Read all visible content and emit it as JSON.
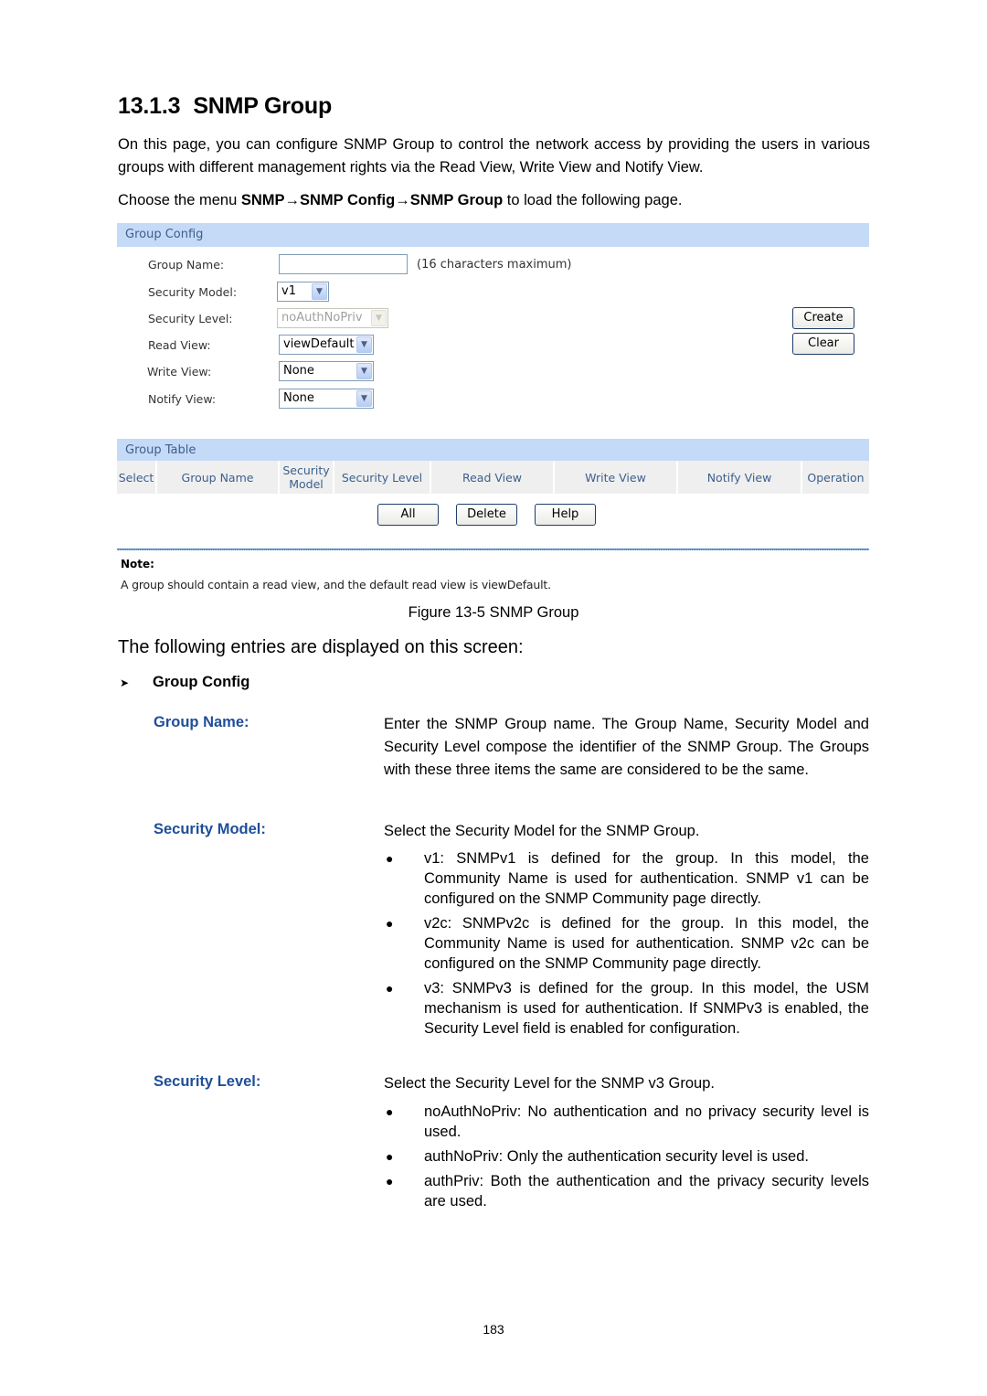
{
  "section": {
    "number": "13.1.3",
    "title": "SNMP Group",
    "intro": "On this page, you can configure SNMP Group to control the network access by providing the users in various groups with different management rights via the Read View, Write View and Notify View.",
    "menu_prefix": "Choose the menu ",
    "menu_path": "SNMP→SNMP Config→SNMP Group",
    "menu_suffix": " to load the following page."
  },
  "figure": {
    "group_config": {
      "header": "Group Config",
      "fields": {
        "group_name": {
          "label": "Group Name:",
          "value": "",
          "hint": "(16 characters maximum)"
        },
        "security_model": {
          "label": "Security Model:",
          "value": "v1"
        },
        "security_level": {
          "label": "Security Level:",
          "value": "noAuthNoPriv",
          "disabled": true
        },
        "read_view": {
          "label": "Read View:",
          "value": "viewDefault"
        },
        "write_view": {
          "label": "Write View:",
          "value": "None"
        },
        "notify_view": {
          "label": "Notify View:",
          "value": "None"
        }
      },
      "buttons": {
        "create": "Create",
        "clear": "Clear"
      }
    },
    "group_table": {
      "header": "Group Table",
      "columns": [
        "Select",
        "Group Name",
        "Security Model",
        "Security Level",
        "Read View",
        "Write View",
        "Notify View",
        "Operation"
      ],
      "buttons": {
        "all": "All",
        "delete": "Delete",
        "help": "Help"
      }
    },
    "note": {
      "title": "Note:",
      "text": "A group should contain a read view, and the default read view is viewDefault."
    },
    "dropdown_icon": "chevron-down-icon",
    "caption": "Figure 13-5 SNMP Group"
  },
  "entries_lead": "The following entries are displayed on this screen:",
  "subsection": {
    "bullet_icon": "arrowhead-bullet",
    "title": "Group Config"
  },
  "definitions": [
    {
      "term": "Group Name:",
      "description": "Enter the SNMP Group name. The Group Name, Security Model and Security Level compose the identifier of the SNMP Group. The Groups with these three items the same are considered to be the same.",
      "bullets": []
    },
    {
      "term": "Security Model:",
      "description": "Select the Security Model for the SNMP Group.",
      "bullets": [
        "v1: SNMPv1 is defined for the group. In this model, the Community Name is used for authentication. SNMP v1 can be configured on the SNMP Community page directly.",
        "v2c: SNMPv2c is defined for the group. In this model, the Community Name is used for authentication. SNMP v2c can be configured on the SNMP Community page directly.",
        "v3: SNMPv3 is defined for the group. In this model, the USM mechanism is used for authentication. If SNMPv3 is enabled, the Security Level field is enabled for configuration."
      ]
    },
    {
      "term": "Security Level:",
      "description": "Select the Security Level for the SNMP v3 Group.",
      "bullets": [
        "noAuthNoPriv: No authentication and no privacy security level is used.",
        "authNoPriv: Only the authentication security level is used.",
        "authPriv: Both the authentication and the privacy security levels are used."
      ]
    }
  ],
  "colors": {
    "term": "#1f4e9a",
    "panel_header": "#c5daf7",
    "panel_text": "#3b5f8f"
  },
  "page_number": "183"
}
